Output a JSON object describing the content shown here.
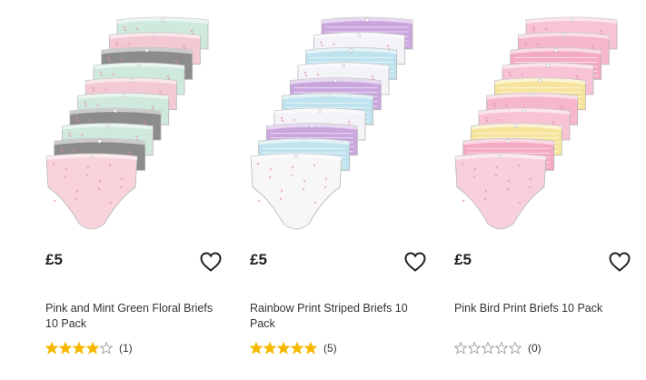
{
  "products": [
    {
      "price": "£5",
      "title": "Pink and Mint Green Floral Briefs 10 Pack",
      "rating": 4,
      "rating_count": "(1)",
      "image_icon": "pink-mint-floral-briefs-image",
      "wishlist_icon": "heart-outline-icon",
      "colors": [
        "#cfe9dd",
        "#f3c9d4",
        "#8c8c8c",
        "#cfe9dd",
        "#f3c9d4",
        "#cfe9dd",
        "#8c8c8c",
        "#cfe9dd",
        "#8c8c8c",
        "#f8d3da"
      ]
    },
    {
      "price": "£5",
      "title": "Rainbow Print Striped Briefs 10 Pack",
      "rating": 5,
      "rating_count": "(5)",
      "image_icon": "rainbow-striped-briefs-image",
      "wishlist_icon": "heart-outline-icon",
      "colors": [
        "#c9a6de",
        "#f4f4f8",
        "#bfe3ee",
        "#f4f4f8",
        "#c9a6de",
        "#bfe3ee",
        "#f4f4f8",
        "#c9a6de",
        "#bfe3ee",
        "#f7f7f7"
      ]
    },
    {
      "price": "£5",
      "title": "Pink Bird Print Briefs 10 Pack",
      "rating": 0,
      "rating_count": "(0)",
      "image_icon": "pink-bird-print-briefs-image",
      "wishlist_icon": "heart-outline-icon",
      "colors": [
        "#f8c3d4",
        "#f6b6cc",
        "#f4a9c4",
        "#f8c3d4",
        "#f6e49c",
        "#f6b6cc",
        "#f8c3d4",
        "#f6e49c",
        "#f4a9c4",
        "#f8d0dd"
      ]
    }
  ],
  "theme": {
    "star_filled": "#f5b900",
    "star_empty_stroke": "#9a9a9a",
    "text": "#222222"
  }
}
